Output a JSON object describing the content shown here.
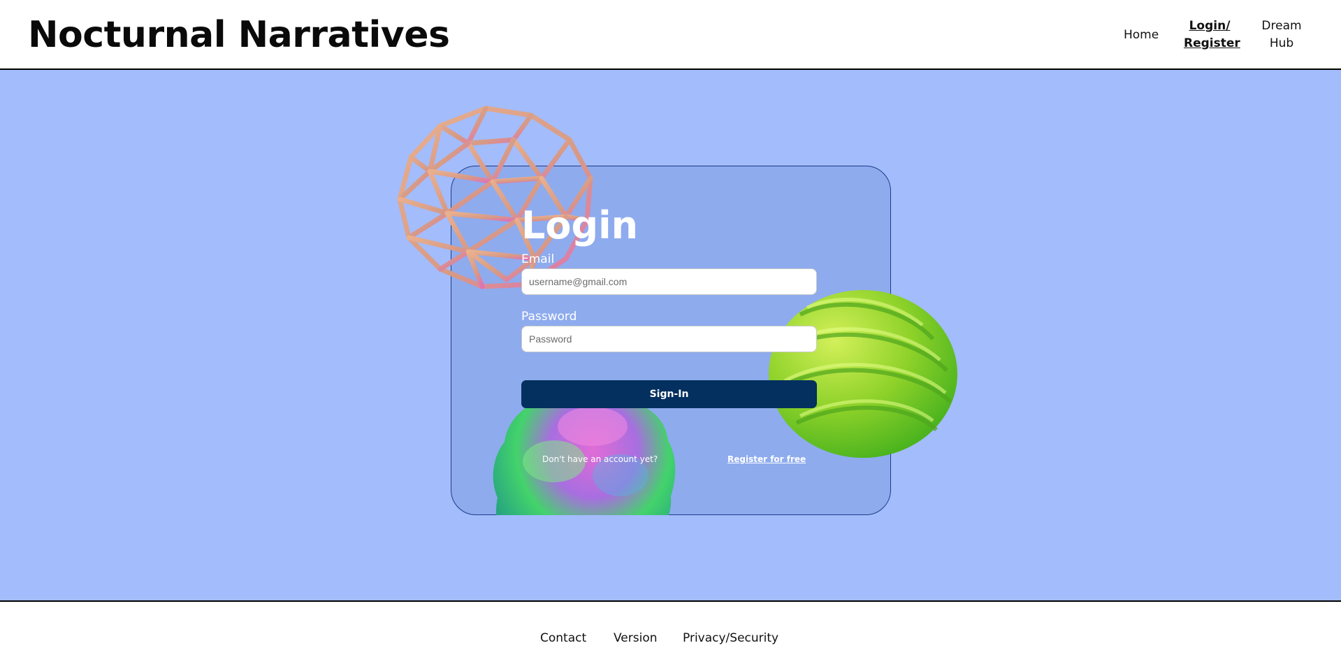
{
  "header": {
    "brand": "Nocturnal Narratives",
    "nav": {
      "home": "Home",
      "login_line1": "Login/",
      "login_line2": "Register",
      "dream_line1": "Dream",
      "dream_line2": "Hub"
    }
  },
  "login": {
    "title": "Login",
    "email_label": "Email",
    "email_placeholder": "username@gmail.com",
    "password_label": "Password",
    "password_placeholder": "Password",
    "signin_label": "Sign-In",
    "no_account_text": "Don't have an account yet?",
    "register_link": "Register for free"
  },
  "footer": {
    "contact": "Contact",
    "version": "Version",
    "privacy": "Privacy/Security"
  },
  "colors": {
    "background": "#a3bcfb",
    "card": "#8eabee",
    "button": "#03305f"
  },
  "decorations": [
    "wireframe-sphere",
    "iridescent-blob",
    "green-ridged-sphere"
  ]
}
